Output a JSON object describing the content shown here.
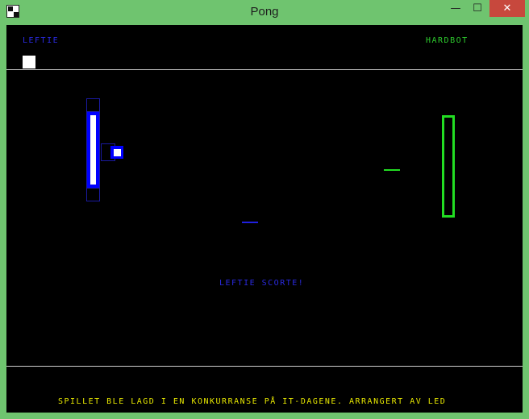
{
  "window": {
    "title": "Pong",
    "minimize_glyph": "—",
    "maximize_glyph": "☐",
    "close_glyph": "✕"
  },
  "scoreboard": {
    "left_player": "LEFTIE",
    "right_player": "HARDBOT",
    "left_points_shown": 1
  },
  "game": {
    "message": "LEFTIE SCORTE!"
  },
  "footer": {
    "text": "SPILLET BLE LAGD I EN KONKURRANSE PÅ IT-DAGENE. ARRANGERT AV LED"
  },
  "colors": {
    "left_player": "#0000ff",
    "right_player": "#22dd22",
    "footer_text": "#e6e600",
    "background": "#000000",
    "window_frame": "#6fc46f",
    "close_button": "#c7483d"
  }
}
